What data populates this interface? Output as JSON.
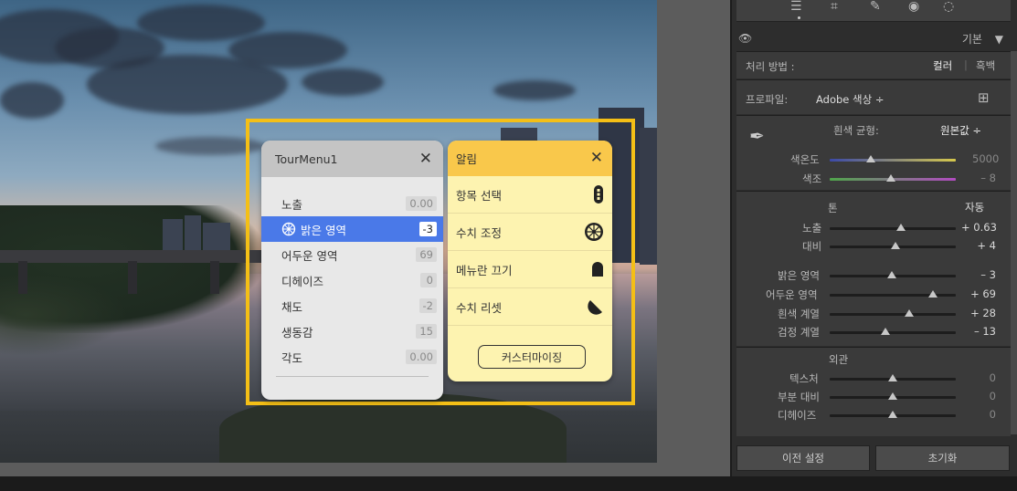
{
  "tour_menu": {
    "title": "TourMenu1",
    "items": [
      {
        "label": "노출",
        "value": "0.00"
      },
      {
        "label": "밝은 영역",
        "value": "-3"
      },
      {
        "label": "어두운 영역",
        "value": "69"
      },
      {
        "label": "디헤이즈",
        "value": "0"
      },
      {
        "label": "채도",
        "value": "-2"
      },
      {
        "label": "생동감",
        "value": "15"
      },
      {
        "label": "각도",
        "value": "0.00"
      }
    ]
  },
  "notification": {
    "title": "알림",
    "items": [
      {
        "label": "항목 선택",
        "icon": "pill-icon"
      },
      {
        "label": "수치 조정",
        "icon": "dial-icon"
      },
      {
        "label": "메뉴란 끄기",
        "icon": "dome-icon"
      },
      {
        "label": "수치 리셋",
        "icon": "moon-icon"
      }
    ],
    "customize_label": "커스터마이징"
  },
  "panel": {
    "section_title": "기본",
    "treatment_label": "처리 방법 :",
    "treatment_color": "컬러",
    "treatment_sep": "|",
    "treatment_bw": "흑백",
    "profile_label": "프로파일:",
    "profile_value": "Adobe 색상 ÷",
    "wb_label": "흰색 균형:",
    "wb_value": "원본값 ÷",
    "temp_label": "색온도",
    "temp_value": "5000",
    "tint_label": "색조",
    "tint_value": "– 8",
    "tone_title": "톤",
    "auto_label": "자동",
    "sliders_tone": [
      {
        "label": "노출",
        "value": "+ 0.63"
      },
      {
        "label": "대비",
        "value": "+ 4"
      }
    ],
    "sliders_tone2": [
      {
        "label": "밝은 영역",
        "value": "– 3"
      },
      {
        "label": "어두운 영역",
        "value": "+ 69"
      },
      {
        "label": "흰색 계열",
        "value": "+ 28"
      },
      {
        "label": "검정 계열",
        "value": "– 13"
      }
    ],
    "presence_title": "외관",
    "sliders_presence": [
      {
        "label": "텍스처",
        "value": "0"
      },
      {
        "label": "부분 대비",
        "value": "0"
      },
      {
        "label": "디헤이즈",
        "value": "0"
      }
    ],
    "prev_settings": "이전 설정",
    "reset": "초기화"
  }
}
